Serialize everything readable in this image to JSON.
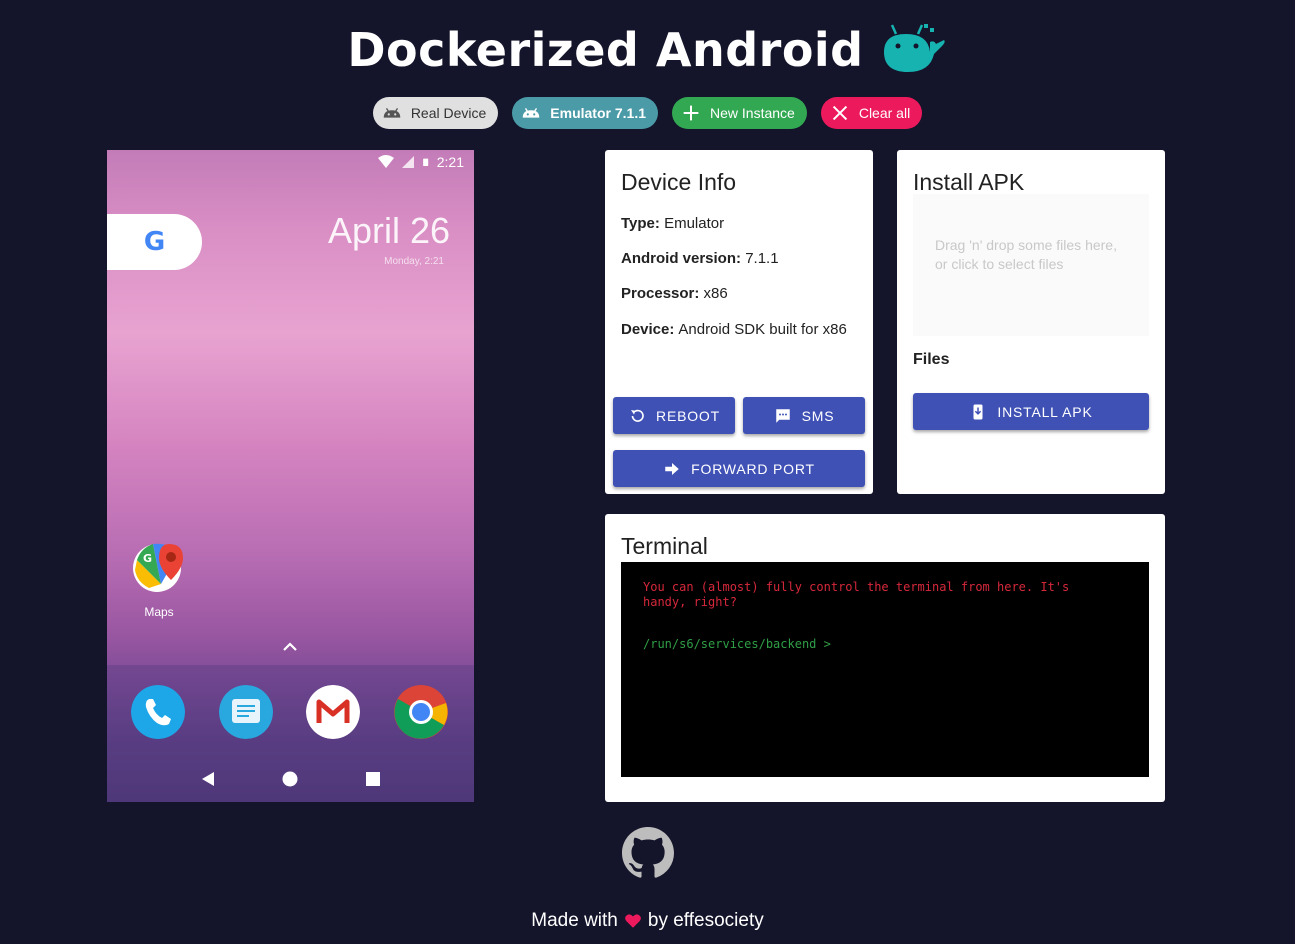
{
  "header": {
    "title": "Dockerized Android"
  },
  "chips": {
    "real_device": "Real Device",
    "emulator": "Emulator 7.1.1",
    "new_instance": "New Instance",
    "clear_all": "Clear all"
  },
  "phone": {
    "status_time": "2:21",
    "date_big": "April 26",
    "date_small": "Monday, 2:21",
    "maps_label": "Maps"
  },
  "device_info": {
    "title": "Device Info",
    "type_label": "Type:",
    "type_value": "Emulator",
    "android_label": "Android version:",
    "android_value": "7.1.1",
    "processor_label": "Processor:",
    "processor_value": "x86",
    "device_label": "Device:",
    "device_value": "Android SDK built for x86",
    "reboot_label": "REBOOT",
    "sms_label": "SMS",
    "forward_label": "FORWARD PORT"
  },
  "install_apk": {
    "title": "Install APK",
    "dropzone_text": "Drag 'n' drop some files here, or click to select files",
    "files_label": "Files",
    "install_label": "INSTALL APK"
  },
  "terminal": {
    "title": "Terminal",
    "message": "You can (almost) fully control the terminal from here. It's handy, right?",
    "prompt": "/run/s6/services/backend >"
  },
  "footer": {
    "made_with": "Made with",
    "by": "by effesociety"
  },
  "colors": {
    "background": "#14142b",
    "primary": "#3f51b5",
    "chip_emulator": "#4a9ba7",
    "chip_new": "#33a852",
    "chip_clear": "#ec1a5d",
    "heart": "#ec1a5d"
  }
}
